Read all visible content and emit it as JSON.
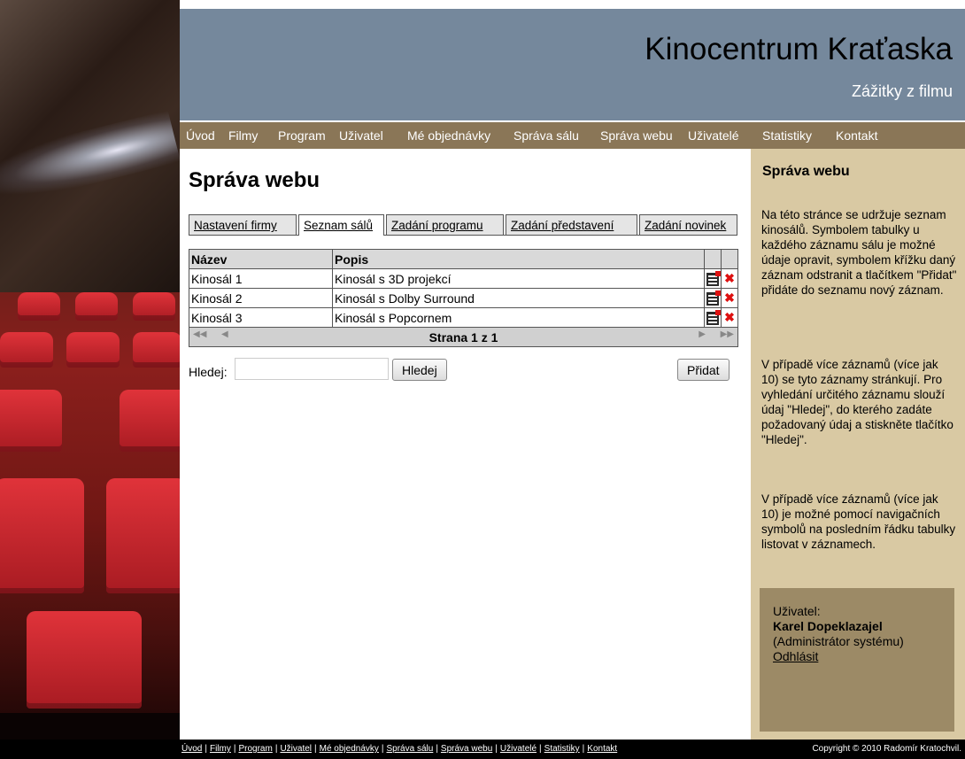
{
  "header": {
    "title": "Kinocentrum Kraťaska",
    "subtitle": "Zážitky z filmu"
  },
  "nav": [
    "Úvod",
    "Filmy",
    "Program",
    "Uživatel",
    "Mé objednávky",
    "Správa sálu",
    "Správa webu",
    "Uživatelé",
    "Statistiky",
    "Kontakt"
  ],
  "main": {
    "title": "Správa webu",
    "tabs": [
      "Nastavení firmy",
      "Seznam sálů",
      "Zadání programu",
      "Zadání představení",
      "Zadání novinek"
    ],
    "table": {
      "columns": [
        "Název",
        "Popis"
      ],
      "rows": [
        [
          "Kinosál 1",
          "Kinosál s 3D projekcí"
        ],
        [
          "Kinosál 2",
          "Kinosál s Dolby Surround"
        ],
        [
          "Kinosál 3",
          "Kinosál s Popcornem"
        ]
      ],
      "pager": "Strana 1 z 1",
      "pager_first": "◀◀",
      "pager_prev": "◀",
      "pager_next": "▶",
      "pager_last": "▶▶"
    },
    "search": {
      "label": "Hledej:",
      "button": "Hledej",
      "value": ""
    },
    "add_button": "Přidat"
  },
  "sidebar": {
    "title": "Správa webu",
    "paragraphs": [
      "Na této stránce se udržuje seznam kinosálů. Symbolem tabulky u každého záznamu sálu je možné údaje opravit, symbolem křížku daný záznam odstranit a tlačítkem \"Přidat\" přidáte do seznamu nový záznam.",
      "V případě více záznamů (více jak 10) se tyto záznamy stránkují. Pro vyhledání určitého záznamu slouží údaj \"Hledej\", do kterého zadáte požadovaný údaj a stiskněte tlačítko \"Hledej\".",
      "V případě více záznamů (více jak 10) je možné pomocí navigačních symbolů na posledním řádku tabulky listovat v záznamech."
    ],
    "user": {
      "label": "Uživatel:",
      "name": "Karel Dopeklazajel",
      "role": "(Administrátor systému)",
      "logout": "Odhlásit"
    }
  },
  "footer": {
    "links": [
      "Úvod",
      "Filmy",
      "Program",
      "Uživatel",
      "Mé objednávky",
      "Správa sálu",
      "Správa webu",
      "Uživatelé",
      "Statistiky",
      "Kontakt"
    ],
    "copyright": "Copyright © 2010 Radomír Kratochvil."
  },
  "colors": {
    "header": "#75889c",
    "nav": "#8a7657",
    "sidebar": "#d9c9a3",
    "userbox": "#9c8a66"
  }
}
